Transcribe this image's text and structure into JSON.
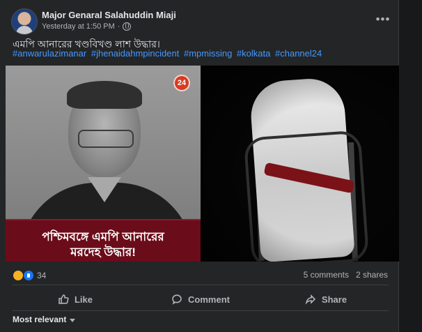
{
  "post": {
    "author": "Major Genaral Salahuddin Miaji",
    "timestamp": "Yesterday at 1:50 PM",
    "visibility_icon": "globe-icon",
    "more_icon": "more-horizontal-icon",
    "text": "এমপি আনারের খণ্ডবিখণ্ড লাশ উদ্ধার।",
    "hashtags": [
      "#anwarulazimanar",
      "#jhenaidahmpincident",
      "#mpmissing",
      "#kolkata",
      "#channel24"
    ]
  },
  "media": {
    "left_logo": "24",
    "caption_lines": [
      "পশ্চিমবঙ্গে এমপি আনারের",
      "মরদেহ উদ্ধার!"
    ]
  },
  "engagement": {
    "reaction_count": "34",
    "comments": "5 comments",
    "shares": "2 shares"
  },
  "actions": {
    "like": "Like",
    "comment": "Comment",
    "share": "Share"
  },
  "comments_sort": {
    "selected": "Most relevant"
  },
  "colors": {
    "card_bg": "#242526",
    "page_bg": "#18191a",
    "text_primary": "#e4e6eb",
    "text_secondary": "#b0b3b8",
    "link": "#4599ff",
    "caption_bg": "#6b0c1a",
    "like_blue": "#1877f2"
  }
}
